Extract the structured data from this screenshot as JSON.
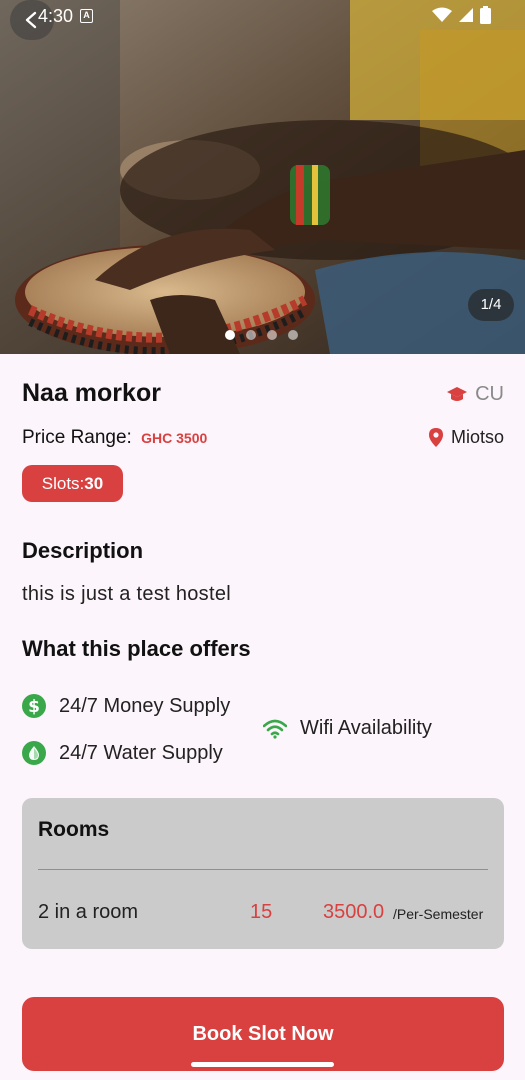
{
  "status_bar": {
    "time": "4:30",
    "badge": "A"
  },
  "hero": {
    "pager_text": "1/4",
    "page_count": 4,
    "active_index": 0
  },
  "hostel": {
    "name": "Naa morkor",
    "university": "CU",
    "price_label": "Price Range:",
    "price_value": "GHC 3500",
    "location": "Miotso",
    "slots_label": "Slots:",
    "slots_value": "30"
  },
  "description": {
    "heading": "Description",
    "text": "this is just a test hostel"
  },
  "offers": {
    "heading": "What this place offers",
    "items": [
      {
        "label": "24/7 Money Supply",
        "icon": "dollar-icon"
      },
      {
        "label": "24/7 Water Supply",
        "icon": "water-drop-icon"
      },
      {
        "label": "Wifi Availability",
        "icon": "wifi-icon"
      }
    ]
  },
  "rooms": {
    "heading": "Rooms",
    "rows": [
      {
        "name": "2 in a room",
        "count": "15",
        "price": "3500.0",
        "unit": "/Per-Semester"
      }
    ]
  },
  "cta": {
    "label": "Book Slot Now"
  },
  "colors": {
    "accent": "#d94040",
    "amenity_icon": "#3aa84a",
    "background": "#fcf5fb",
    "card": "#cbcbcb"
  }
}
